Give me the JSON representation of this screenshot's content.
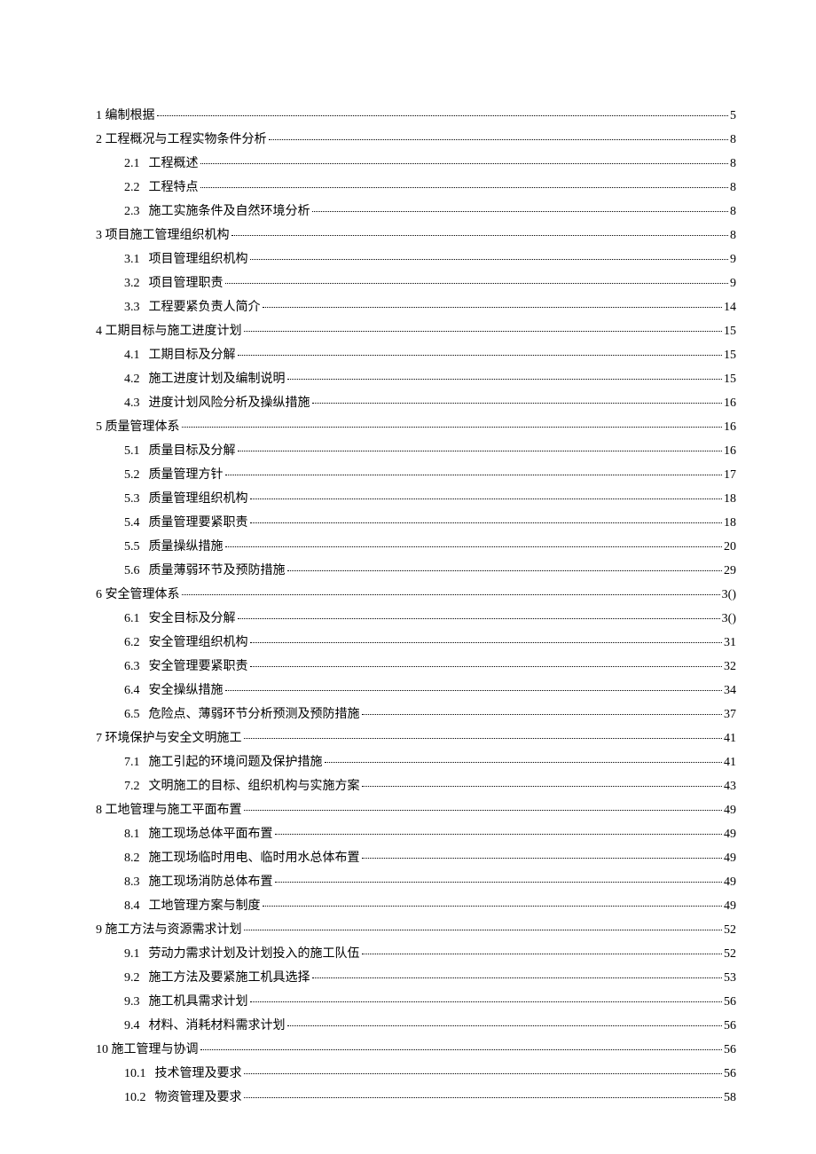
{
  "toc": [
    {
      "level": 1,
      "num": "1",
      "title": "编制根据",
      "page": "5"
    },
    {
      "level": 1,
      "num": "2",
      "title": "工程概况与工程实物条件分析",
      "page": "8"
    },
    {
      "level": 2,
      "num": "2.1",
      "title": "工程概述",
      "page": "8"
    },
    {
      "level": 2,
      "num": "2.2",
      "title": "工程特点",
      "page": "8"
    },
    {
      "level": 2,
      "num": "2.3",
      "title": "施工实施条件及自然环境分析",
      "page": "8"
    },
    {
      "level": 1,
      "num": "3",
      "title": "项目施工管理组织机构",
      "page": "8"
    },
    {
      "level": 2,
      "num": "3.1",
      "title": "项目管理组织机构",
      "page": "9"
    },
    {
      "level": 2,
      "num": "3.2",
      "title": "项目管理职责",
      "page": "9"
    },
    {
      "level": 2,
      "num": "3.3",
      "title": "工程要紧负责人简介",
      "page": "14"
    },
    {
      "level": 1,
      "num": "4",
      "title": "工期目标与施工进度计划",
      "page": "15"
    },
    {
      "level": 2,
      "num": "4.1",
      "title": "工期目标及分解",
      "page": "15"
    },
    {
      "level": 2,
      "num": "4.2",
      "title": "施工进度计划及编制说明",
      "page": "15"
    },
    {
      "level": 2,
      "num": "4.3",
      "title": "进度计划风险分析及操纵措施",
      "page": "16"
    },
    {
      "level": 1,
      "num": "5",
      "title": "质量管理体系",
      "page": "16"
    },
    {
      "level": 2,
      "num": "5.1",
      "title": "质量目标及分解",
      "page": "16"
    },
    {
      "level": 2,
      "num": "5.2",
      "title": "质量管理方针",
      "page": "17"
    },
    {
      "level": 2,
      "num": "5.3",
      "title": "质量管理组织机构",
      "page": "18"
    },
    {
      "level": 2,
      "num": "5.4",
      "title": "质量管理要紧职责",
      "page": "18"
    },
    {
      "level": 2,
      "num": "5.5",
      "title": "质量操纵措施",
      "page": "20"
    },
    {
      "level": 2,
      "num": "5.6",
      "title": "质量薄弱环节及预防措施",
      "page": "29"
    },
    {
      "level": 1,
      "num": "6",
      "title": "安全管理体系",
      "page": "3()"
    },
    {
      "level": 2,
      "num": "6.1",
      "title": "安全目标及分解",
      "page": "3()"
    },
    {
      "level": 2,
      "num": "6.2",
      "title": "安全管理组织机构",
      "page": "31"
    },
    {
      "level": 2,
      "num": "6.3",
      "title": "安全管理要紧职责",
      "page": "32"
    },
    {
      "level": 2,
      "num": "6.4",
      "title": "安全操纵措施",
      "page": "34"
    },
    {
      "level": 2,
      "num": "6.5",
      "title": "危险点、薄弱环节分析预测及预防措施",
      "page": "37"
    },
    {
      "level": 1,
      "num": "7",
      "title": "环境保护与安全文明施工",
      "page": "41"
    },
    {
      "level": 2,
      "num": "7.1",
      "title": "施工引起的环境问题及保护措施",
      "page": "41"
    },
    {
      "level": 2,
      "num": "7.2",
      "title": "文明施工的目标、组织机构与实施方案",
      "page": "43"
    },
    {
      "level": 1,
      "num": "8",
      "title": "工地管理与施工平面布置",
      "page": "49"
    },
    {
      "level": 2,
      "num": "8.1",
      "title": "施工现场总体平面布置",
      "page": "49"
    },
    {
      "level": 2,
      "num": "8.2",
      "title": "施工现场临时用电、临时用水总体布置",
      "page": "49"
    },
    {
      "level": 2,
      "num": "8.3",
      "title": "施工现场消防总体布置",
      "page": "49"
    },
    {
      "level": 2,
      "num": "8.4",
      "title": "工地管理方案与制度",
      "page": "49"
    },
    {
      "level": 1,
      "num": "9",
      "title": "施工方法与资源需求计划",
      "page": "52"
    },
    {
      "level": 2,
      "num": "9.1",
      "title": "劳动力需求计划及计划投入的施工队伍",
      "page": "52"
    },
    {
      "level": 2,
      "num": "9.2",
      "title": "施工方法及要紧施工机具选择",
      "page": "53"
    },
    {
      "level": 2,
      "num": "9.3",
      "title": "施工机具需求计划",
      "page": "56"
    },
    {
      "level": 2,
      "num": "9.4",
      "title": "材料、消耗材料需求计划",
      "page": "56"
    },
    {
      "level": 1,
      "num": "10",
      "title": "施工管理与协调",
      "page": "56"
    },
    {
      "level": 2,
      "num": "10.1",
      "title": "技术管理及要求",
      "page": "56"
    },
    {
      "level": 2,
      "num": "10.2",
      "title": "物资管理及要求",
      "page": "58"
    }
  ]
}
